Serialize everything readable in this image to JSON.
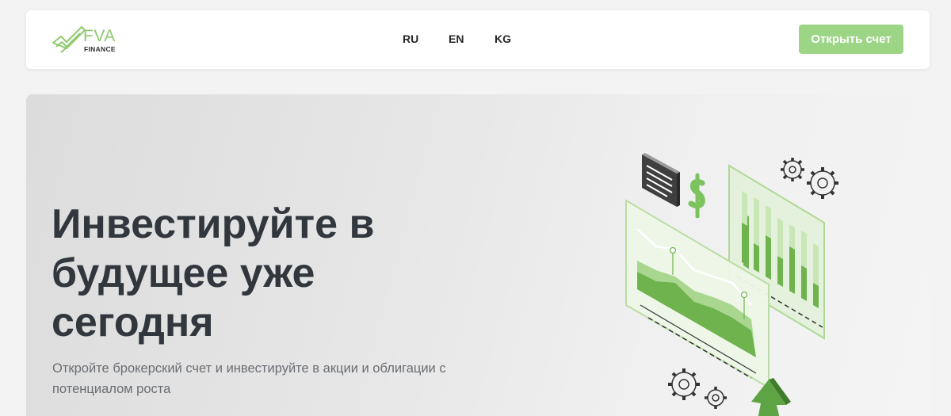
{
  "header": {
    "logo": {
      "name": "FVA",
      "sub": "FINANCE"
    },
    "languages": [
      "RU",
      "EN",
      "KG"
    ],
    "cta_label": "Открыть счет"
  },
  "hero": {
    "title": "Инвестируйте в будущее уже сегодня",
    "subtitle": "Откройте брокерский счет и инвестируйте в акции и облигации с потенциалом роста"
  },
  "colors": {
    "accent": "#9dd586",
    "brand_green": "#8fca6e",
    "title_text": "#32373d",
    "subtitle_text": "#6a6e73"
  },
  "icons": [
    "logo-check-icon",
    "dollar-icon",
    "gear-icon",
    "document-icon",
    "up-arrow-icon"
  ]
}
